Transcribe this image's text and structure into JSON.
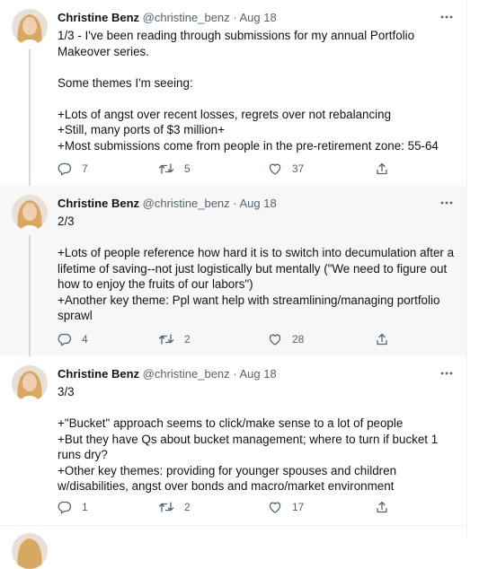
{
  "tweets": [
    {
      "author_name": "Christine Benz",
      "meta": "@christine_benz · Aug 18",
      "lines": [
        "1/3 - I've been reading through submissions for my annual Portfolio",
        "Makeover series.",
        "",
        "Some themes I'm seeing:",
        "",
        "+Lots of angst over recent losses, regrets over not rebalancing",
        "+Still, many ports of $3 million+",
        "+Most submissions come from people in the pre-retirement zone: 55-64"
      ],
      "replies": "7",
      "retweets": "5",
      "likes": "37"
    },
    {
      "author_name": "Christine Benz",
      "meta": "@christine_benz · Aug 18",
      "lines": [
        "2/3",
        "",
        "+Lots of people reference how hard it is to switch into decumulation after a",
        "lifetime of saving--not just logistically but mentally (\"We need to figure out",
        "how to enjoy the fruits of our labors\")",
        "+Another key theme: Ppl want help with streamlining/managing portfolio",
        "sprawl"
      ],
      "replies": "4",
      "retweets": "2",
      "likes": "28"
    },
    {
      "author_name": "Christine Benz",
      "meta": "@christine_benz · Aug 18",
      "lines": [
        "3/3",
        "",
        "+\"Bucket\" approach seems to click/make sense to a lot of people",
        "+But they have Qs about bucket management; where to turn if bucket 1",
        "runs dry?",
        "+Other key themes: providing for younger spouses and children",
        "w/disabilities, angst over bonds and macro/market environment"
      ],
      "replies": "1",
      "retweets": "2",
      "likes": "17"
    }
  ],
  "icons": {
    "more": "more-options-icon",
    "reply": "reply-icon",
    "retweet": "retweet-icon",
    "like": "like-icon",
    "share": "share-icon"
  },
  "colors": {
    "text": "#0f1419",
    "secondary": "#536471",
    "thread_line": "#cfd9de",
    "highlight_bg": "#f7f7f7"
  }
}
